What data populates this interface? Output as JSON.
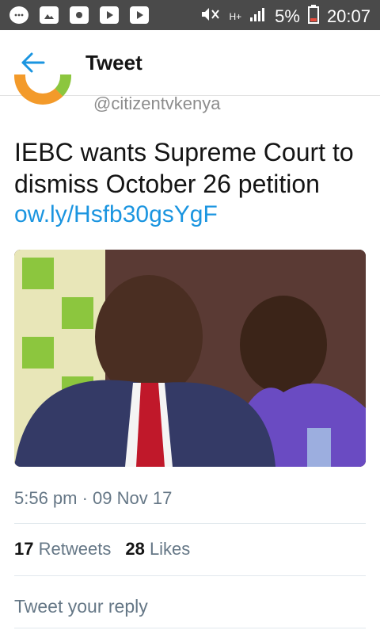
{
  "status_bar": {
    "battery": "5%",
    "time": "20:07",
    "network": "H+"
  },
  "appbar": {
    "title": "Tweet"
  },
  "tweet": {
    "handle": "@citizentvkenya",
    "text": "IEBC wants Supreme Court to dismiss October 26 petition",
    "link": "ow.ly/Hsfb30gsYgF",
    "timestamp": "5:56 pm · 09 Nov 17",
    "retweets_count": "17",
    "retweets_label": "Retweets",
    "likes_count": "28",
    "likes_label": "Likes",
    "reply_placeholder": "Tweet your reply"
  },
  "colors": {
    "accent": "#1b95e0",
    "muted": "#657786",
    "statusbar": "#4a4a4a"
  }
}
